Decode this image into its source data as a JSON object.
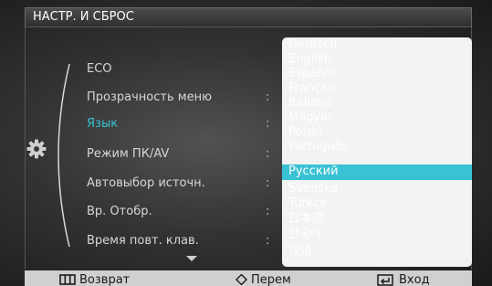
{
  "title": "НАСТР. И СБРОС",
  "menu": {
    "items": [
      {
        "label": "ECO",
        "has_colon": false
      },
      {
        "label": "Прозрачность меню",
        "has_colon": true
      },
      {
        "label": "Язык",
        "has_colon": true
      },
      {
        "label": "Режим ПК/AV",
        "has_colon": true
      },
      {
        "label": "Автовыбор источн.",
        "has_colon": true
      },
      {
        "label": "Вр. Отобр.",
        "has_colon": true
      },
      {
        "label": "Время повт. клав.",
        "has_colon": true
      }
    ],
    "active_item": "Язык",
    "colon": ":"
  },
  "language_dropdown": {
    "options": [
      "Deutsch",
      "English",
      "Español",
      "Français",
      "Italiano",
      "Magyar",
      "Polski",
      "Português",
      "Русский",
      "Svenska",
      "Türkçe",
      "日本語",
      "한국어",
      "汉语"
    ],
    "selected": "Русский"
  },
  "bottom_bar": {
    "return_label": "Возврат",
    "move_label": "Перем",
    "enter_label": "Вход"
  },
  "icons": {
    "category": "gear-icon",
    "scroll": "chevron-down-icon",
    "return": "menu-grid-icon",
    "move": "up-down-arrow-icon",
    "enter": "enter-icon"
  },
  "colors": {
    "accent": "#39c2d4",
    "dropdown_bg": "#f3f3f3",
    "bottom_bar_bg": "#d0d0d0"
  }
}
